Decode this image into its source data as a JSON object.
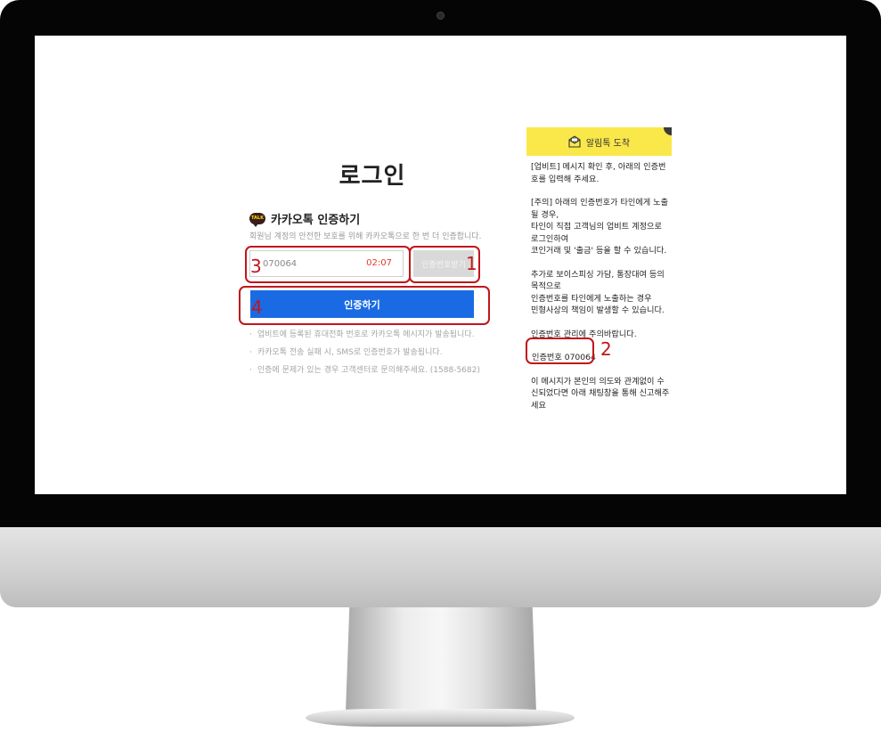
{
  "login": {
    "title": "로그인",
    "kakao_badge": "TALK",
    "kakao_title": "카카오톡 인증하기",
    "kakao_desc": "회원님 계정의 안전한 보호를 위해 카카오톡으로 한 번 더 인증합니다.",
    "code_value": "070064",
    "timer": "02:07",
    "request_button": "인증번호받기",
    "verify_button": "인증하기",
    "notes": [
      "업비트에 등록된 휴대전화 번호로 카카오톡 메시지가 발송됩니다.",
      "카카오톡 전송 실패 시, SMS로 인증번호가 발송됩니다.",
      "인증에 문제가 있는 경우 고객센터로 문의해주세요. (1588-5682)"
    ]
  },
  "annotations": {
    "request": "1",
    "code": "2",
    "input": "3",
    "verify": "4"
  },
  "notification": {
    "title": "알림톡 도착",
    "paragraphs": [
      "[업비트] 메시지 확인 후, 아래의 인증번호를 입력해 주세요.",
      "[주의] 아래의 인증번호가 타인에게 노출될 경우,\n타인이 직접 고객님의 업비트 계정으로 로그인하여\n코인거래 및 '출금' 등을 할 수 있습니다.",
      "추가로 보이스피싱 가담, 통장대여 등의 목적으로\n인증번호를 타인에게 노출하는 경우\n민형사상의 책임이 발생할 수 있습니다.",
      "인증번호 관리에 주의바랍니다."
    ],
    "code_line": "인증번호 070064",
    "footer": "이 메시지가 본인의 의도와 관계없이 수신되었다면 아래 채팅창을 통해 신고해주세요"
  },
  "colors": {
    "kakao_yellow": "#fae84a",
    "primary_blue": "#1a6be3",
    "annotation_red": "#c0161b",
    "timer_red": "#e0392b"
  }
}
